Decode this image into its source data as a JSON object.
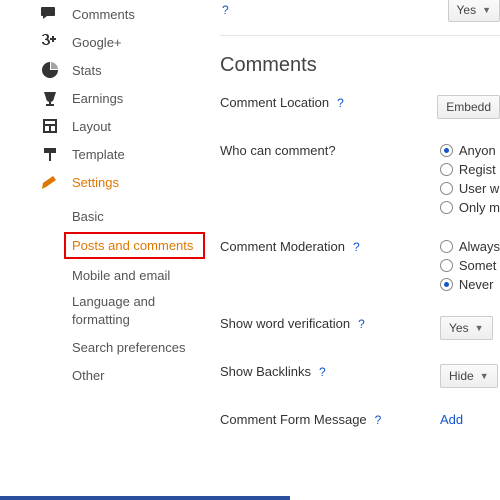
{
  "sidebar": {
    "items": [
      {
        "label": "Comments"
      },
      {
        "label": "Google+"
      },
      {
        "label": "Stats"
      },
      {
        "label": "Earnings"
      },
      {
        "label": "Layout"
      },
      {
        "label": "Template"
      },
      {
        "label": "Settings"
      }
    ],
    "sub": [
      {
        "label": "Basic"
      },
      {
        "label": "Posts and comments"
      },
      {
        "label": "Mobile and email"
      },
      {
        "label": "Language and formatting"
      },
      {
        "label": "Search preferences"
      },
      {
        "label": "Other"
      }
    ]
  },
  "top": {
    "help": "?",
    "yes": "Yes",
    "chev": "▼"
  },
  "comments": {
    "heading": "Comments",
    "location": {
      "label": "Comment Location",
      "help": "?",
      "button": "Embedd"
    },
    "who": {
      "label": "Who can comment?",
      "options": [
        "Anyon",
        "Regist",
        "User w",
        "Only m"
      ],
      "checked": 0
    },
    "moderation": {
      "label": "Comment Moderation",
      "help": "?",
      "options": [
        "Always",
        "Somet",
        "Never"
      ],
      "checked": 2
    },
    "verification": {
      "label": "Show word verification",
      "help": "?",
      "value": "Yes",
      "chev": "▼"
    },
    "backlinks": {
      "label": "Show Backlinks",
      "help": "?",
      "value": "Hide",
      "chev": "▼"
    },
    "form": {
      "label": "Comment Form Message",
      "help": "?",
      "link": "Add"
    }
  }
}
